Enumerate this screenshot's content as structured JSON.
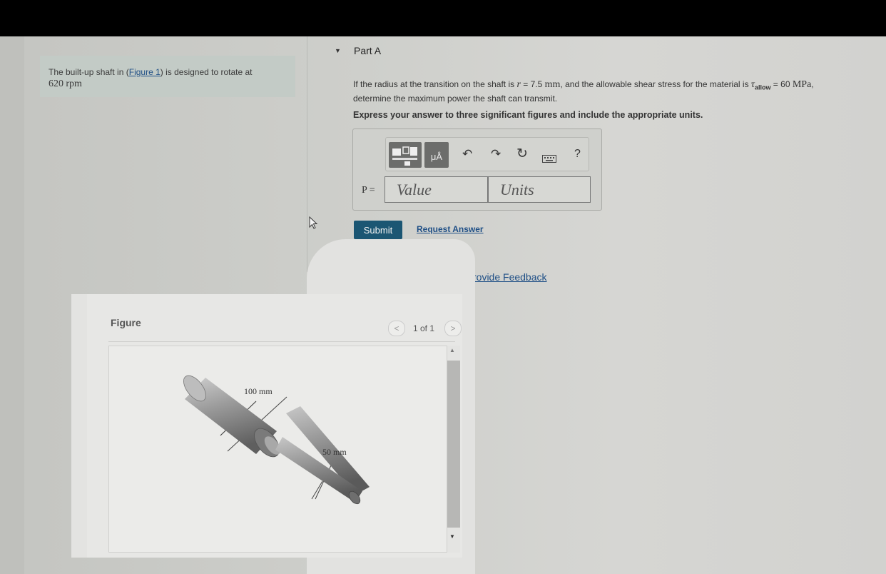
{
  "problem": {
    "text_before_link": "The built-up shaft in (",
    "link": "Figure 1",
    "text_after_link": ") is designed to rotate at",
    "speed_value": "620",
    "speed_unit": "rpm"
  },
  "part": {
    "title": "Part A",
    "q_line1_a": "If the radius at the transition on the shaft is",
    "q_r_symbol": "r",
    "q_r_value": "= 7.5",
    "q_r_unit": "mm",
    "q_line1_b": ", and the allowable shear stress for the material is",
    "q_tau_symbol": "τ",
    "q_tau_sub": "allow",
    "q_tau_value": "= 60",
    "q_tau_unit": "MPa",
    "q_line2": "determine the maximum power the shaft can transmit.",
    "instructions": "Express your answer to three significant figures and include the appropriate units."
  },
  "toolbar": {
    "units_button_label": "μÅ",
    "undo": "↶",
    "redo": "↷",
    "reset": "↻",
    "help": "?"
  },
  "answer": {
    "label": "P =",
    "value_placeholder": "Value",
    "units_placeholder": "Units"
  },
  "actions": {
    "submit": "Submit",
    "request_answer": "Request Answer",
    "feedback": "rovide Feedback"
  },
  "figure": {
    "label": "Figure",
    "pager": "1 of 1",
    "prev": "<",
    "next": ">",
    "dim_large": "100 mm",
    "dim_small": "50 mm"
  }
}
